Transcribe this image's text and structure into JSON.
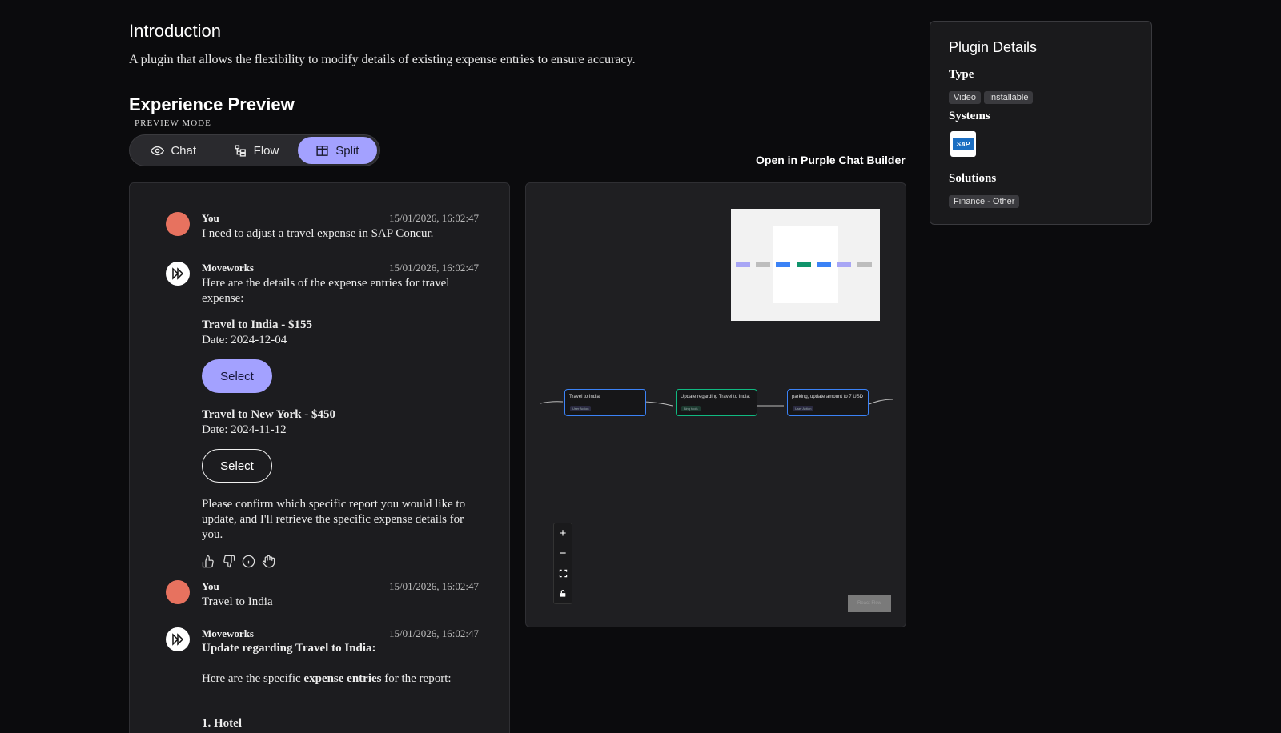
{
  "intro": {
    "title": "Introduction",
    "description": "A plugin that allows the flexibility to modify details of existing expense entries to ensure accuracy."
  },
  "experience": {
    "title": "Experience Preview",
    "mode_label": "PREVIEW MODE",
    "tabs": [
      {
        "label": "Chat",
        "icon": "eye-icon",
        "active": false
      },
      {
        "label": "Flow",
        "icon": "flow-icon",
        "active": false
      },
      {
        "label": "Split",
        "icon": "split-icon",
        "active": true
      }
    ],
    "open_builder": "Open in Purple Chat Builder"
  },
  "chat": {
    "messages": [
      {
        "sender": "You",
        "timestamp": "15/01/2026, 16:02:47",
        "text": "I need to adjust a travel expense in SAP Concur."
      },
      {
        "sender": "Moveworks",
        "timestamp": "15/01/2026, 16:02:47",
        "text": "Here are the details of the expense entries for travel expense:"
      },
      {
        "sender": "You",
        "timestamp": "15/01/2026, 16:02:47",
        "text": "Travel to India"
      },
      {
        "sender": "Moveworks",
        "timestamp": "15/01/2026, 16:02:47",
        "text": "Update regarding Travel to India:"
      }
    ],
    "entries": [
      {
        "title": "Travel to India - $155",
        "date": "Date: 2024-12-04",
        "button": "Select"
      },
      {
        "title": "Travel to New York - $450",
        "date": "Date: 2024-11-12",
        "button": "Select"
      }
    ],
    "confirm_text": "Please confirm which specific report you would like to update, and I'll retrieve the specific expense details for you.",
    "feedback_icons": [
      "thumbs-up-icon",
      "thumbs-down-icon",
      "info-icon",
      "hand-icon"
    ],
    "followup": {
      "prefix": "Here are the specific ",
      "bold": "expense entries",
      "suffix": " for the report:",
      "list_first": "1. Hotel"
    }
  },
  "flow": {
    "nodes": [
      {
        "title": "Travel to India",
        "tag": "User Action",
        "color": "#3b82f6"
      },
      {
        "title": "Update regarding Travel to India:",
        "tag": "Bing tools",
        "color": "#10b981"
      },
      {
        "title": "parking, update amount to 7 USD",
        "tag": "User Action",
        "color": "#3b82f6"
      }
    ],
    "zoom_controls": [
      "+",
      "−",
      "fit-view-icon",
      "lock-icon"
    ],
    "badge": "React Flow"
  },
  "details": {
    "title": "Plugin Details",
    "type_label": "Type",
    "types": [
      "Video",
      "Installable"
    ],
    "systems_label": "Systems",
    "system_logo": "SAP",
    "solutions_label": "Solutions",
    "solutions": [
      "Finance - Other"
    ]
  },
  "colors": {
    "accent": "#a3a1ff",
    "user_avatar": "#e7725f",
    "background": "#0b0b0d"
  }
}
